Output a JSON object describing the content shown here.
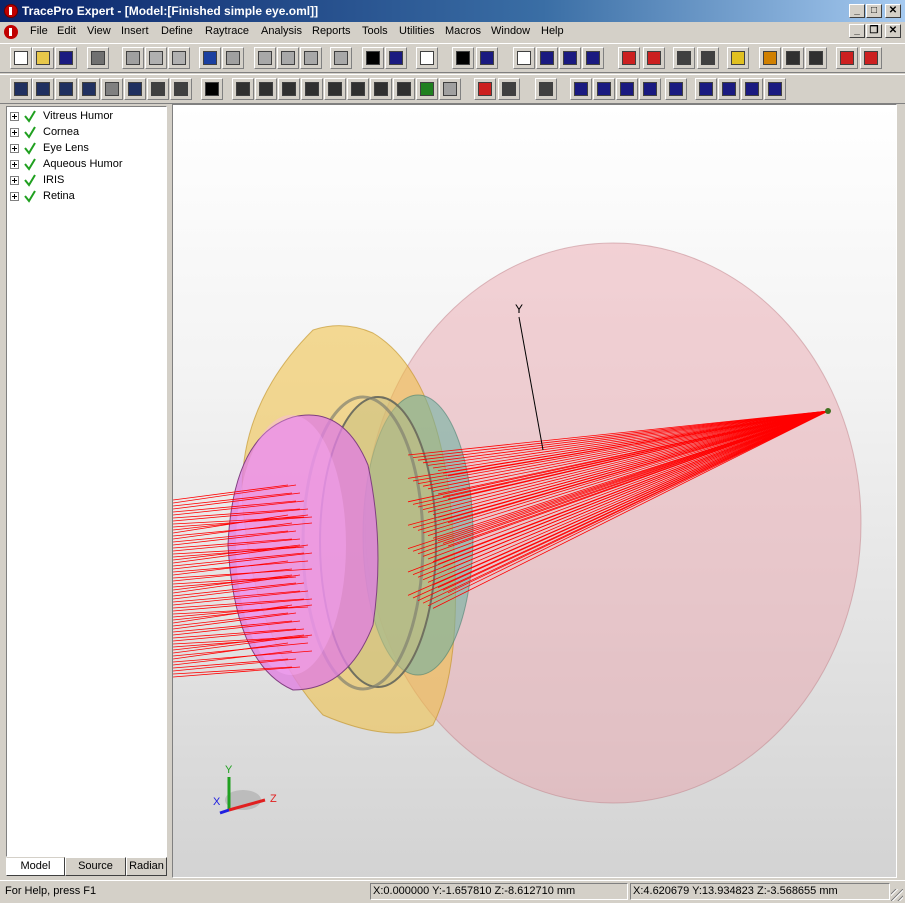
{
  "window": {
    "title": "TracePro Expert - [Model:[Finished simple eye.oml]]",
    "controls": {
      "minimize": "_",
      "maximize": "□",
      "close": "✕"
    }
  },
  "menu": [
    "File",
    "Edit",
    "View",
    "Insert",
    "Define",
    "Raytrace",
    "Analysis",
    "Reports",
    "Tools",
    "Utilities",
    "Macros",
    "Window",
    "Help"
  ],
  "toolbar": {
    "row1": [
      {
        "name": "new-icon",
        "color": "#ffffff"
      },
      {
        "name": "open-folder-icon",
        "color": "#e8c84a"
      },
      {
        "name": "save-icon",
        "color": "#1a1a80"
      },
      {
        "name": "print-icon",
        "color": "#707070"
      },
      {
        "name": "cut-icon",
        "color": "#a0a0a0"
      },
      {
        "name": "copy-icon",
        "color": "#b0b0b0"
      },
      {
        "name": "paste-icon",
        "color": "#b0b0b0"
      },
      {
        "name": "undo-icon",
        "color": "#1a3fa0"
      },
      {
        "name": "redo-icon",
        "color": "#a0a0a0"
      },
      {
        "name": "boolean-union-icon",
        "color": "#a8a8a8"
      },
      {
        "name": "boolean-subtract-icon",
        "color": "#a8a8a8"
      },
      {
        "name": "boolean-intersect-icon",
        "color": "#a8a8a8"
      },
      {
        "name": "sweep-icon",
        "color": "#a8a8a8"
      },
      {
        "name": "select-arrow-icon",
        "color": "#000000"
      },
      {
        "name": "select-surface-icon",
        "color": "#1a1a80"
      },
      {
        "name": "notes-icon",
        "color": "#ffffff"
      },
      {
        "name": "help-icon",
        "color": "#000000"
      },
      {
        "name": "context-help-icon",
        "color": "#1a1a80"
      },
      {
        "name": "single-window-icon",
        "color": "#ffffff"
      },
      {
        "name": "cascade-icon",
        "color": "#1a1a80"
      },
      {
        "name": "tile-horizontal-icon",
        "color": "#1a1a80"
      },
      {
        "name": "tile-vertical-icon",
        "color": "#1a1a80"
      },
      {
        "name": "trace-rays-icon",
        "color": "#cc2020"
      },
      {
        "name": "rev-trace-icon",
        "color": "#cc2020"
      },
      {
        "name": "irradiance-map-icon",
        "color": "#404040"
      },
      {
        "name": "candela-plot-icon",
        "color": "#404040"
      },
      {
        "name": "ray-sorting-icon",
        "color": "#e0c020"
      },
      {
        "name": "source-icon",
        "color": "#d08000"
      },
      {
        "name": "target-icon",
        "color": "#303030"
      },
      {
        "name": "plot-icon",
        "color": "#303030"
      },
      {
        "name": "srt-icon",
        "color": "#cc2020"
      },
      {
        "name": "opl-icon",
        "color": "#cc2020"
      }
    ],
    "row2": [
      {
        "name": "zoom-in-icon",
        "color": "#203060"
      },
      {
        "name": "zoom-out-icon",
        "color": "#203060"
      },
      {
        "name": "zoom-window-icon",
        "color": "#203060"
      },
      {
        "name": "zoom-all-icon",
        "color": "#203060"
      },
      {
        "name": "zoom-previous-icon",
        "color": "#808080"
      },
      {
        "name": "zoom-selection-icon",
        "color": "#203060"
      },
      {
        "name": "rotate-view-icon",
        "color": "#404040"
      },
      {
        "name": "orbit-view-icon",
        "color": "#404040"
      },
      {
        "name": "pan-icon",
        "color": "#000000"
      },
      {
        "name": "view-xy-icon",
        "color": "#303030"
      },
      {
        "name": "view-yz-icon",
        "color": "#303030"
      },
      {
        "name": "view-xz-icon",
        "color": "#303030"
      },
      {
        "name": "view-yx-icon",
        "color": "#303030"
      },
      {
        "name": "view-zy-icon",
        "color": "#303030"
      },
      {
        "name": "view-zx-icon",
        "color": "#303030"
      },
      {
        "name": "view-iso-icon",
        "color": "#303030"
      },
      {
        "name": "view-axes-icon",
        "color": "#303030"
      },
      {
        "name": "render-shaded-icon",
        "color": "#208020"
      },
      {
        "name": "hidden-line-icon",
        "color": "#a0a0a0"
      },
      {
        "name": "check-icon",
        "color": "#cc2020"
      },
      {
        "name": "measure-icon",
        "color": "#404040"
      },
      {
        "name": "ray-display-icon",
        "color": "#404040"
      },
      {
        "name": "lens-icon",
        "color": "#1a1a80"
      },
      {
        "name": "mirror-icon",
        "color": "#1a1a80"
      },
      {
        "name": "cone-icon",
        "color": "#1a1a80"
      },
      {
        "name": "bracket-icon",
        "color": "#1a1a80"
      },
      {
        "name": "prism-icon",
        "color": "#1a1a80"
      },
      {
        "name": "block-icon",
        "color": "#1a1a80"
      },
      {
        "name": "square-icon",
        "color": "#1a1a80"
      },
      {
        "name": "sphere-icon",
        "color": "#1a1a80"
      },
      {
        "name": "reflector-icon",
        "color": "#1a1a80"
      }
    ]
  },
  "tree": {
    "items": [
      {
        "label": "Vitreus Humor"
      },
      {
        "label": "Cornea"
      },
      {
        "label": "Eye Lens"
      },
      {
        "label": "Aqueous Humor"
      },
      {
        "label": "IRIS"
      },
      {
        "label": "Retina"
      }
    ]
  },
  "tabs": [
    "Model",
    "Source",
    "Radian"
  ],
  "viewport": {
    "axis_label_y": "Y",
    "triad": {
      "x": "X",
      "y": "Y",
      "z": "Z"
    },
    "colors": {
      "vitreous": "#e8a0a8",
      "cornea": "#f0c040",
      "lens": "#e080e0",
      "iris": "#70b0a0",
      "rays": "#ff0000"
    }
  },
  "status": {
    "help": "For Help, press F1",
    "coords1": "X:0.000000 Y:-1.657810 Z:-8.612710 mm",
    "coords2": "X:4.620679 Y:13.934823 Z:-3.568655 mm"
  }
}
